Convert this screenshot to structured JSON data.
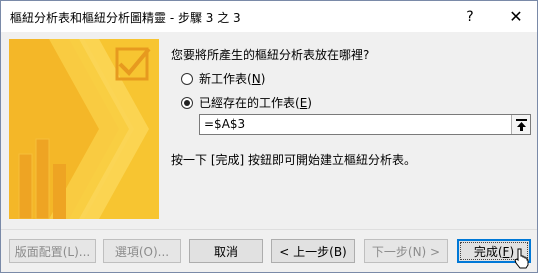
{
  "window": {
    "title": "樞紐分析表和樞紐分析圖精靈 - 步驟 3 之 3",
    "help_glyph": "?",
    "close_glyph": "✕"
  },
  "main": {
    "question": "您要將所產生的樞紐分析表放在哪裡?",
    "options": [
      {
        "label": "新工作表",
        "hotkey": "N",
        "selected": false
      },
      {
        "label": "已經存在的工作表",
        "hotkey": "E",
        "selected": true
      }
    ],
    "reference_value": "=$A$3",
    "hint": "按一下 [完成] 按鈕即可開始建立樞紐分析表。"
  },
  "buttons": {
    "layout": "版面配置(L)...",
    "options": "選項(O)...",
    "cancel": "取消",
    "back": "< 上一步(B)",
    "next": "下一步(N) >",
    "finish_label": "完成(",
    "finish_hotkey": "F",
    "finish_end": ")"
  },
  "icons": {
    "collapse_button": "collapse-dialog-icon",
    "wizard_art": "wizard-checkmark-art",
    "cursor": "mouse-pointer-icon"
  },
  "colors": {
    "art_yellow": "#f7c531",
    "art_orange": "#eea423",
    "default_button_border": "#0078d7"
  }
}
